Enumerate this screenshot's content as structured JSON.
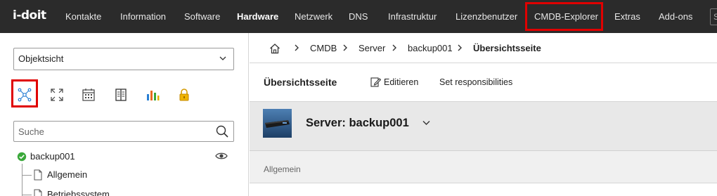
{
  "app": {
    "logo": "i-doit"
  },
  "nav": {
    "items": [
      {
        "label": "Kontakte"
      },
      {
        "label": "Information"
      },
      {
        "label": "Software"
      },
      {
        "label": "Hardware"
      },
      {
        "label": "Netzwerk"
      },
      {
        "label": "DNS"
      },
      {
        "label": "Infrastruktur"
      },
      {
        "label": "Lizenzbenutzer"
      },
      {
        "label": "CMDB-Explorer"
      },
      {
        "label": "Extras"
      },
      {
        "label": "Add-ons"
      }
    ],
    "active": "Hardware",
    "highlighted": "CMDB-Explorer",
    "search_placeholder": "S"
  },
  "sidebar": {
    "view_select": "Objektsicht",
    "tools": [
      {
        "icon": "cmdb-explorer-icon",
        "highlighted": true
      },
      {
        "icon": "expand-icon"
      },
      {
        "icon": "calendar-icon"
      },
      {
        "icon": "book-icon"
      },
      {
        "icon": "bar-chart-icon"
      },
      {
        "icon": "lock-icon"
      }
    ],
    "search_placeholder": "Suche",
    "tree": {
      "root": "backup001",
      "root_status": "ok",
      "children": [
        "Allgemein",
        "Betriebssystem"
      ]
    }
  },
  "breadcrumb": {
    "items": [
      "CMDB",
      "Server",
      "backup001",
      "Übersichtsseite"
    ]
  },
  "toolbar": {
    "title": "Übersichtsseite",
    "edit_label": "Editieren",
    "responsibilities_label": "Set responsibilities"
  },
  "object": {
    "title": "Server: backup001"
  },
  "section": {
    "label": "Allgemein"
  },
  "colors": {
    "nav_bg": "#2b2b2b",
    "highlight": "#e00000",
    "status_ok": "#3aa83a",
    "object_header_bg": "#e8e8e8"
  }
}
